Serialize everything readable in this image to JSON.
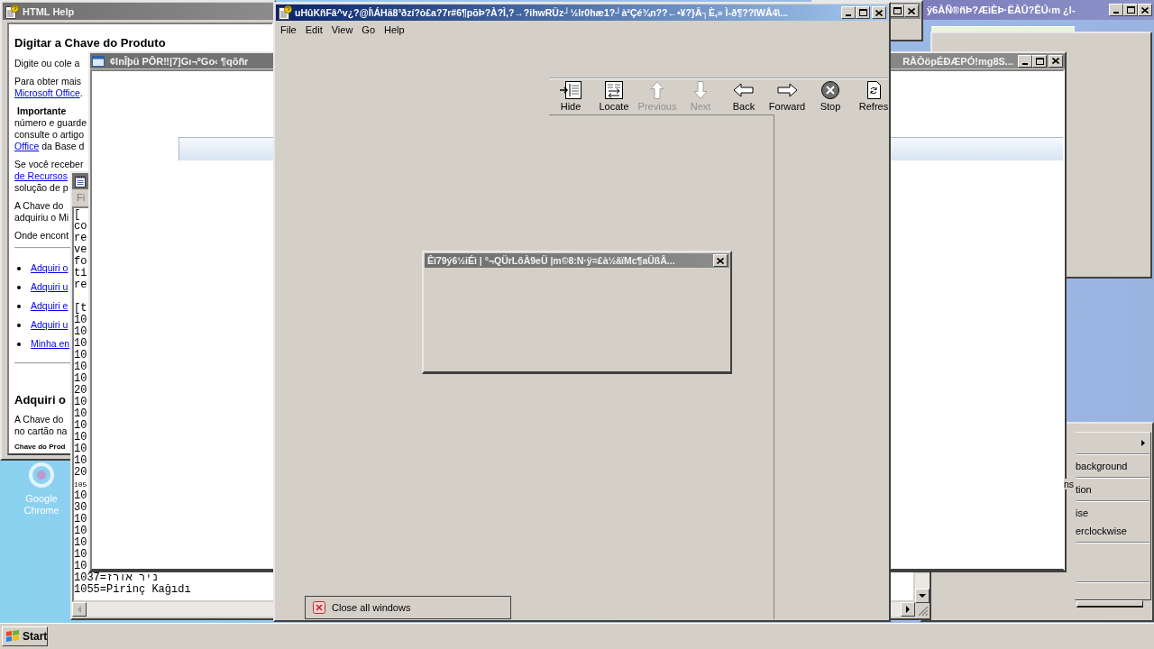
{
  "desktop": {
    "icons": [
      {
        "label": "Google Chrome"
      }
    ]
  },
  "help_window": {
    "title": "HTML Help",
    "active": false,
    "heading": "Digitar a Chave do Produto",
    "paragraphs": [
      [
        [
          {
            "text": "Digite ou cole a",
            "kind": "text"
          }
        ]
      ],
      [
        [
          {
            "text": "Para obter mais",
            "kind": "text"
          }
        ],
        [
          {
            "text": "Microsoft Office",
            "kind": "link"
          },
          {
            "text": ".",
            "kind": "text"
          }
        ]
      ],
      [
        [
          {
            "text": "Importante",
            "kind": "bold"
          }
        ],
        [
          {
            "text": "número e guarde",
            "kind": "text"
          }
        ],
        [
          {
            "text": "consulte o artigo",
            "kind": "text"
          }
        ],
        [
          {
            "text": "Office",
            "kind": "link"
          },
          {
            "text": " da Base d",
            "kind": "text"
          }
        ]
      ],
      [
        [
          {
            "text": "Se você receber",
            "kind": "text"
          }
        ],
        [
          {
            "text": "de Recursos",
            "kind": "link"
          }
        ],
        [
          {
            "text": "solução de p",
            "kind": "text"
          }
        ]
      ],
      [
        [
          {
            "text": "A Chave do",
            "kind": "text"
          }
        ],
        [
          {
            "text": "adquiriu o Mi",
            "kind": "text"
          }
        ]
      ],
      [
        [
          {
            "text": "Onde encont",
            "kind": "text"
          }
        ]
      ]
    ],
    "links": [
      "Adquiri o",
      "Adquiri u",
      "Adquiri e",
      "Adquiri u",
      "Minha en"
    ],
    "section_heading": "Adquiri o",
    "section_paragraph": [
      "A Chave do",
      "no cartão na"
    ],
    "caption": "Chave do Prod"
  },
  "side_window": {
    "label": "ns"
  },
  "notepad_window": {
    "active": false,
    "menu": [
      "Fi"
    ],
    "blocks": [
      [
        {
          "text": "[",
          "kind": "line"
        },
        {
          "text": "co",
          "kind": "line"
        },
        {
          "text": "re",
          "kind": "line"
        },
        {
          "text": "ve",
          "kind": "line"
        },
        {
          "text": "fo",
          "kind": "line"
        },
        {
          "text": "ti",
          "kind": "line"
        },
        {
          "text": "re",
          "kind": "line"
        }
      ],
      [
        {
          "text": "[t",
          "kind": "line"
        },
        {
          "text": "10",
          "kind": "line"
        },
        {
          "text": "10",
          "kind": "line"
        },
        {
          "text": "10",
          "kind": "line"
        },
        {
          "text": "10",
          "kind": "line"
        },
        {
          "text": "10",
          "kind": "line"
        },
        {
          "text": "10",
          "kind": "line"
        },
        {
          "text": "20",
          "kind": "line"
        },
        {
          "text": "10",
          "kind": "line"
        },
        {
          "text": "10",
          "kind": "line"
        },
        {
          "text": "10",
          "kind": "line"
        },
        {
          "text": "10",
          "kind": "line"
        },
        {
          "text": "10",
          "kind": "line"
        },
        {
          "text": "10",
          "kind": "line"
        },
        {
          "text": "20",
          "kind": "line"
        },
        {
          "text": "105",
          "kind": "small"
        },
        {
          "text": "10",
          "kind": "line"
        },
        {
          "text": "30",
          "kind": "line"
        },
        {
          "text": "10",
          "kind": "line"
        },
        {
          "text": "10",
          "kind": "line"
        },
        {
          "text": "10",
          "kind": "line"
        },
        {
          "text": "10",
          "kind": "line"
        },
        {
          "text": "10",
          "kind": "line"
        },
        {
          "text": "1037=ניר אורז",
          "kind": "line"
        },
        {
          "text": "1055=Pirinç Kağıdı",
          "kind": "line"
        }
      ]
    ]
  },
  "back_window": {
    "active": false
  },
  "top_right_window": {
    "active": false,
    "title": "ÿ6ÀÑ®ñÞ?ÆìÈÞ·ËÀÛ?ÊÚ‹m ¿l-"
  },
  "wide_window": {
    "active": false,
    "title_start": "¢InÎþü PÔR‼|7]Gı¬ºGo‹ ¶qõñr",
    "title_end": "RÀÒöpÉÐÆPÓ!mg8S..."
  },
  "main_window": {
    "active": true,
    "title": "uHûKñFâ^v¿?@Í\\ÁHä8³ðzí?ò£a?7r#6¶põÞ?À?Ì,?→?ihwRÜz┘½lr0hæ1?┘à²Çé¾n??←•¥?}Ä┐È,» Ì-ð¶??lWÅ4\\...",
    "menu": [
      "File",
      "Edit",
      "View",
      "Go",
      "Help"
    ],
    "toolbar": [
      {
        "label": "Hide",
        "disabled": false
      },
      {
        "label": "Locate",
        "disabled": false
      },
      {
        "label": "Previous",
        "disabled": true
      },
      {
        "label": "Next",
        "disabled": true
      },
      {
        "label": "Back",
        "disabled": false
      },
      {
        "label": "Forward",
        "disabled": false
      },
      {
        "label": "Stop",
        "disabled": false
      },
      {
        "label": "Refres",
        "disabled": false
      }
    ],
    "close_all_button": "Close all windows"
  },
  "dialog": {
    "active": false,
    "title": "Êï79ý6½iÉì | °¬QÜrLôÀ9eÜ |m©8:N·ÿ=£à½âïMc¶aÜßÂ..."
  },
  "context_menu": {
    "items": [
      {
        "kind": "submenu"
      },
      {
        "kind": "separator"
      },
      {
        "kind": "item",
        "text": "background"
      },
      {
        "kind": "separator"
      },
      {
        "kind": "item",
        "text": "tion"
      },
      {
        "kind": "separator"
      },
      {
        "kind": "item",
        "text": "ise"
      },
      {
        "kind": "item",
        "text": "erclockwise"
      },
      {
        "kind": "separator"
      },
      {
        "kind": "blank"
      },
      {
        "kind": "separator"
      }
    ]
  },
  "taskbar": {
    "start_label": "Start"
  }
}
